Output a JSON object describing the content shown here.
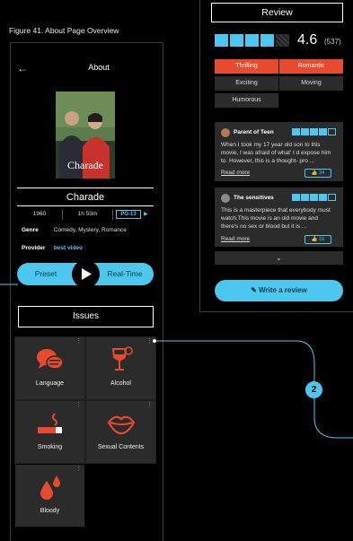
{
  "figure_label": "Figure 41. About Page Overview",
  "about": {
    "title": "About",
    "poster_title": "Charade",
    "movie_title": "Charade",
    "year": "1960",
    "duration": "1h 53m",
    "rating_badge": "PG-13",
    "genre_label": "Genre",
    "genre_value": "Comedy, Mystery, Romance",
    "provider_label": "Provider",
    "provider_value": "best video",
    "toggle_left": "Preset",
    "toggle_right": "Real-Time",
    "issues_title": "Issues"
  },
  "issues": [
    {
      "label": "Language",
      "icon": "speech-bubble-icon"
    },
    {
      "label": "Alcohol",
      "icon": "wine-glass-icon"
    },
    {
      "label": "Smoking",
      "icon": "cigarette-icon"
    },
    {
      "label": "Sexual Contents",
      "icon": "lips-icon"
    },
    {
      "label": "Bloody",
      "icon": "blood-drop-icon"
    }
  ],
  "review": {
    "title": "Review",
    "rating": "4.6",
    "count": "(537)",
    "stars_filled": 4,
    "tags": [
      {
        "label": "Thrilling",
        "selected": true
      },
      {
        "label": "Romantic",
        "selected": true
      },
      {
        "label": "Exciting",
        "selected": false
      },
      {
        "label": "Moving",
        "selected": false
      },
      {
        "label": "Humorous",
        "selected": false
      }
    ],
    "cards": [
      {
        "name": "Parent of Teen",
        "stars": 4,
        "text": "When I took my 17 year old son to this movie, I was afraid of what' I d expose him to. However, this is a thought- pro ...",
        "read_more": "Read more",
        "likes": "24"
      },
      {
        "name": "The sensitives",
        "stars": 4,
        "text": "This is a masterpiece that everybody must watch.This movie is an old movie and there's no sex or blood but it is ...",
        "read_more": "Read more",
        "likes": "16"
      }
    ],
    "write_button": "Write a review"
  },
  "step_number": "2",
  "colors": {
    "accent": "#4cc8f0",
    "orange": "#e84a2e",
    "tile_bg": "#2b2b2b",
    "background": "#000000"
  }
}
